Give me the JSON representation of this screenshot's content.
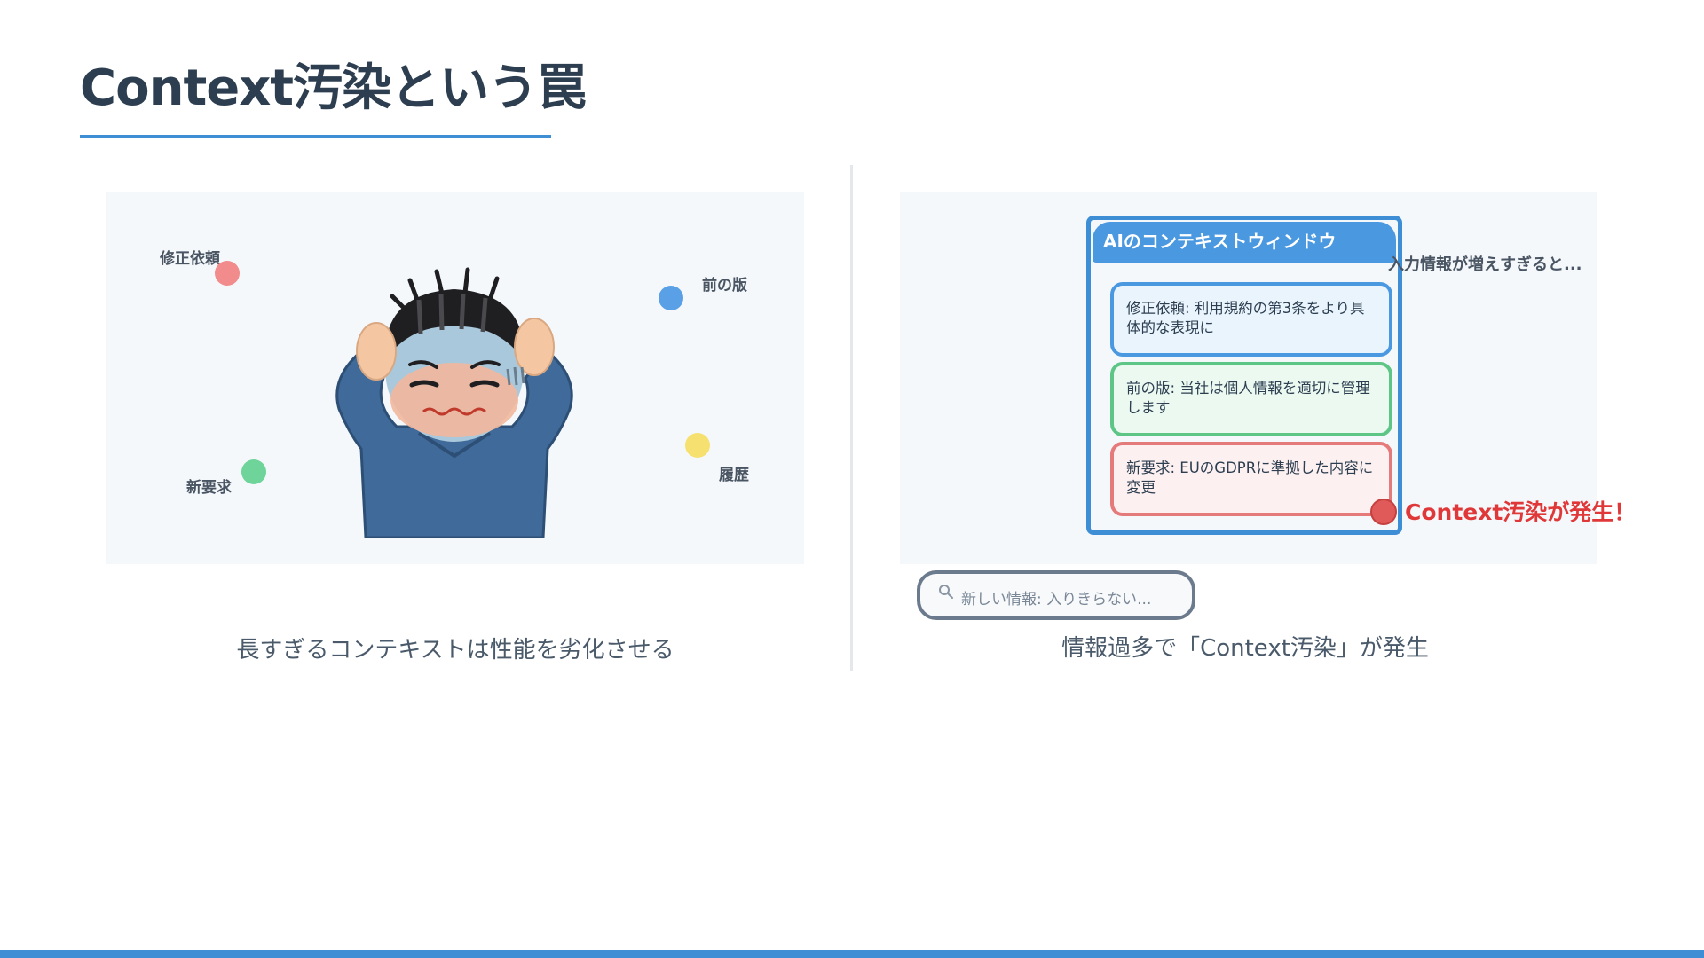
{
  "slide": {
    "title": "Context汚染という罠",
    "accent_color": "#3e8ed6"
  },
  "left": {
    "labels": {
      "fix_request": "修正依頼",
      "previous_version": "前の版",
      "new_request": "新要求",
      "history": "履歴"
    },
    "dot_colors": {
      "fix_request": "#f28b8b",
      "previous_version": "#5aa0e6",
      "new_request": "#6fd49a",
      "history": "#f6e070"
    },
    "illustration": "stressed-person-holding-head",
    "caption": "長すぎるコンテキストは性能を劣化させる"
  },
  "right": {
    "window_title": "AIのコンテキストウィンドウ",
    "cards": [
      {
        "text": "修正依頼: 利用規約の第3条をより具体的な表現に",
        "color": "#4a98e0"
      },
      {
        "text": "前の版: 当社は個人情報を適切に管理します",
        "color": "#5dc586"
      },
      {
        "text": "新要求: EUのGDPRに準拠した内容に変更",
        "color": "#e57a7a"
      }
    ],
    "overflow_note": "入力情報が増えすぎると...",
    "warning": "Context汚染が発生！",
    "warning_color": "#e03838",
    "input_placeholder": "新しい情報: 入りきらない...",
    "caption": "情報過多で「Context汚染」が発生"
  }
}
